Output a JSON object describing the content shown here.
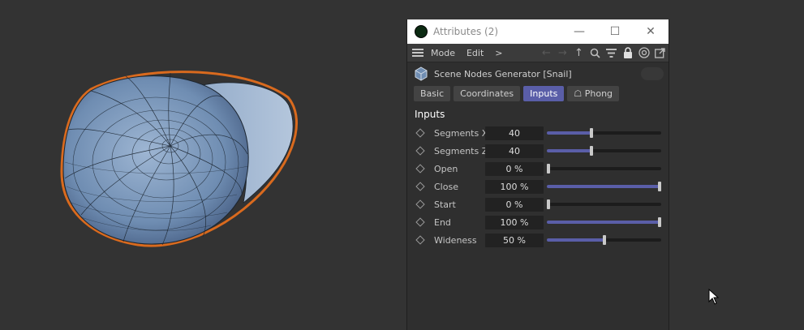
{
  "window": {
    "title": "Attributes (2)",
    "controls": {
      "minimize": "—",
      "maximize": "☐",
      "close": "✕"
    }
  },
  "menubar": {
    "items": [
      "Mode",
      "Edit",
      ">"
    ]
  },
  "object": {
    "name": "Scene Nodes Generator [Snail]"
  },
  "tabs": [
    {
      "label": "Basic",
      "active": false
    },
    {
      "label": "Coordinates",
      "active": false
    },
    {
      "label": "Inputs",
      "active": true
    },
    {
      "label": "☖ Phong",
      "active": false
    }
  ],
  "section": {
    "title": "Inputs"
  },
  "params": [
    {
      "label": "Segments X",
      "value": "40",
      "fraction": 0.39
    },
    {
      "label": "Segments Z",
      "value": "40",
      "fraction": 0.39
    },
    {
      "label": "Open",
      "value": "0 %",
      "fraction": 0.0
    },
    {
      "label": "Close",
      "value": "100 %",
      "fraction": 1.0
    },
    {
      "label": "Start",
      "value": "0 %",
      "fraction": 0.0
    },
    {
      "label": "End",
      "value": "100 %",
      "fraction": 1.0
    },
    {
      "label": "Wideness",
      "value": "50 %",
      "fraction": 0.5
    }
  ],
  "colors": {
    "accent": "#5a5ea8",
    "selection_outline": "#d96a1e",
    "mesh": "#7f9cc0"
  }
}
